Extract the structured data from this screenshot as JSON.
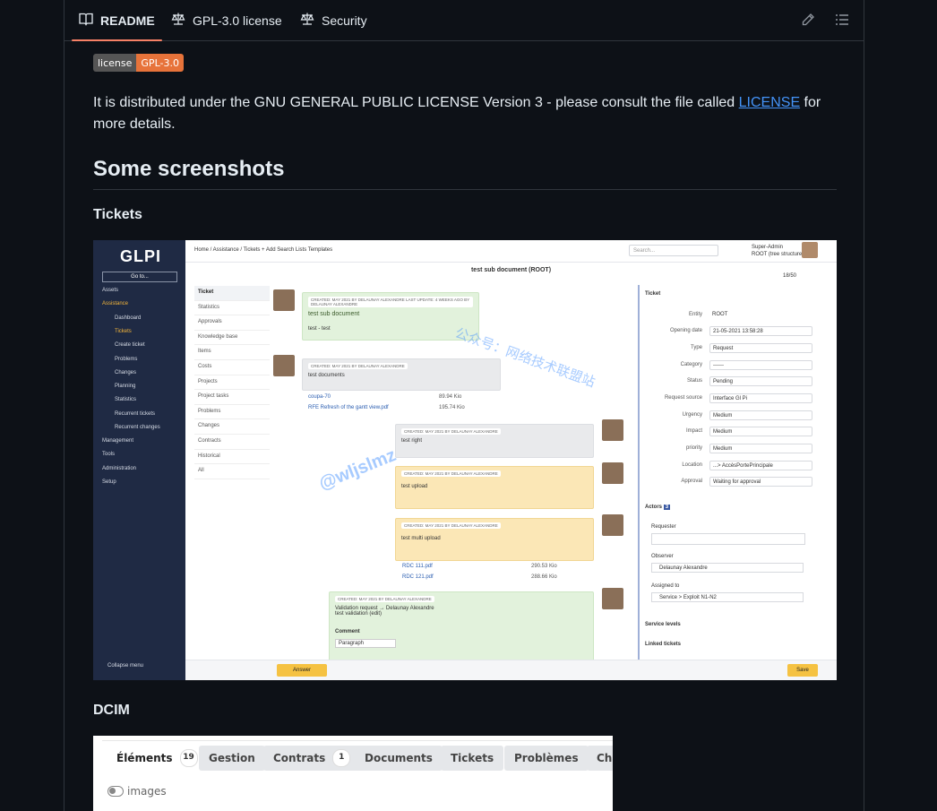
{
  "tabs": [
    {
      "label": "README",
      "icon": "book-icon",
      "active": true
    },
    {
      "label": "GPL-3.0 license",
      "icon": "scale-icon",
      "active": false
    },
    {
      "label": "Security",
      "icon": "scale-icon",
      "active": false
    }
  ],
  "toolbar": {
    "edit_icon": "pencil-icon",
    "outline_icon": "list-icon"
  },
  "badge": {
    "left": "license",
    "right": "GPL-3.0",
    "right_color": "#e7733a"
  },
  "paragraph": {
    "before": "It is distributed under the GNU GENERAL PUBLIC LICENSE Version 3 - please consult the file called ",
    "link": "LICENSE",
    "after": " for more details."
  },
  "heading": "Some screenshots",
  "section1": "Tickets",
  "section2": "DCIM",
  "glpi": {
    "logo": "GLPI",
    "goto": "Go to...",
    "menu": [
      "Assets",
      "Assistance",
      "Dashboard",
      "Tickets",
      "Create ticket",
      "Problems",
      "Changes",
      "Planning",
      "Statistics",
      "Recurrent tickets",
      "Recurrent changes",
      "Management",
      "Tools",
      "Administration",
      "Setup"
    ],
    "collapse": "Collapse menu",
    "breadcrumb": "Home / Assistance / Tickets   + Add   Search   Lists   Templates",
    "search_placeholder": "Search...",
    "user_name": "Super-Admin",
    "user_entity": "ROOT (tree structure)",
    "ticket_title": "test sub document (ROOT)",
    "pager": "18/50",
    "ticket_tabs": [
      "Ticket",
      "Statistics",
      "Approvals",
      "Knowledge base",
      "Items",
      "Costs",
      "Projects",
      "Project tasks",
      "Problems",
      "Changes",
      "Contracts",
      "Historical",
      "All"
    ],
    "timeline": {
      "b1_meta": "CREATED: MAY 2021 BY DELAUNAY ALEXANDRE   LAST UPDATE: 4 WEEKS AGO BY DELAUNAY ALEXANDRE",
      "b1_title": "test sub document",
      "b1_body": "test - test",
      "b2_meta": "CREATED: MAY 2021 BY DELAUNAY ALEXANDRE",
      "b2_body": "test documents",
      "doc1": "coupa-70",
      "doc1_size": "89.94 Kio",
      "doc2": "RFE Refresh of the gantt view.pdf",
      "doc2_size": "195.74 Kio",
      "b3_meta": "CREATED: MAY 2021 BY DELAUNAY ALEXANDRE",
      "b3_body": "test right",
      "b4_meta": "CREATED: MAY 2021 BY DELAUNAY ALEXANDRE",
      "b4_body": "test upload",
      "b5_meta": "CREATED: MAY 2021 BY DELAUNAY ALEXANDRE",
      "b5_body": "test multi upload",
      "doc3": "RDC 111.pdf",
      "doc3_size": "290.53 Kio",
      "doc4": "RDC 121.pdf",
      "doc4_size": "288.66 Kio",
      "b6_meta": "CREATED: MAY 2021 BY DELAUNAY ALEXANDRE",
      "b6_l1": "Validation request → Delaunay Alexandre",
      "b6_l2": "test validation (edit)",
      "comment": "Comment",
      "paragraph_select": "Paragraph"
    },
    "answer": "Answer",
    "save": "Save",
    "ticket_panel": "Ticket",
    "fields": [
      {
        "label": "Entity",
        "value": "ROOT"
      },
      {
        "label": "Opening date",
        "value": "21-05-2021 13:58:28"
      },
      {
        "label": "Type",
        "value": "Request"
      },
      {
        "label": "Category",
        "value": "------"
      },
      {
        "label": "Status",
        "value": "Pending"
      },
      {
        "label": "Request source",
        "value": "Interface Gl Pi"
      },
      {
        "label": "Urgency",
        "value": "Medium"
      },
      {
        "label": "Impact",
        "value": "Medium"
      },
      {
        "label": "priority",
        "value": "Medium"
      },
      {
        "label": "Location",
        "value": "...> AccèsPortePrincipale"
      },
      {
        "label": "Approval",
        "value": "Waiting for approval"
      }
    ],
    "actors": "Actors",
    "actors_count": "3",
    "requester": "Requester",
    "observer": "Observer",
    "observer_value": "Delaunay Alexandre",
    "assigned": "Assigned to",
    "assigned_value": "Service > Exploit N1-N2",
    "service_levels": "Service levels",
    "linked_tickets": "Linked tickets",
    "watermark_cn": "公众号：网络技术联盟站",
    "watermark_en": "@wljslmz"
  },
  "dcim": {
    "tabs": [
      {
        "label": "Éléments",
        "count": "19"
      },
      {
        "label": "Gestion",
        "count": ""
      },
      {
        "label": "Contrats",
        "count": "1"
      },
      {
        "label": "Documents",
        "count": ""
      },
      {
        "label": "Tickets",
        "count": ""
      },
      {
        "label": "Problèmes",
        "count": ""
      },
      {
        "label": "Cha",
        "count": ""
      }
    ],
    "toggle_label": "images"
  }
}
